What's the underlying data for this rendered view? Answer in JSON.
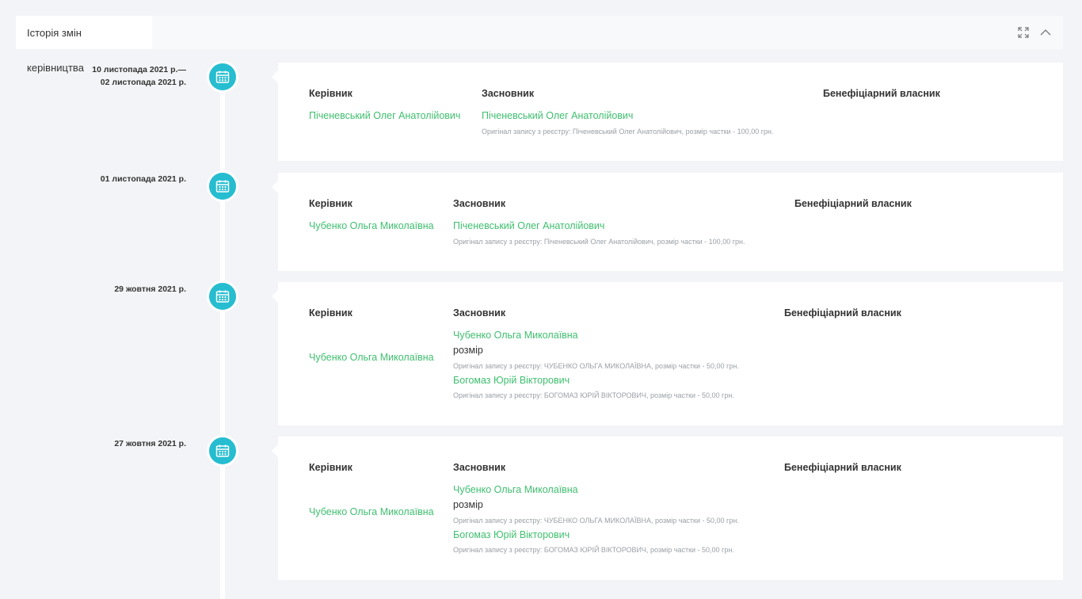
{
  "header": {
    "title": "Історія змін керівництва",
    "expand_icon": "expand-icon",
    "collapse_icon": "chevron-up-icon"
  },
  "colors": {
    "accent": "#26bdd0",
    "link": "#3fbf6f"
  },
  "entries": [
    {
      "date_line1": "10 листопада 2021 р.—",
      "date_line2": "02 листопада 2021 р.",
      "head_manager": "Керівник",
      "head_founder": "Засновник",
      "head_beneficiary": "Бенефіціарний власник",
      "manager": "Піченевський Олег Анатолійович",
      "founders": [
        {
          "name": "Піченевський Олег Анатолійович",
          "note": "Оригінал запису з реєстру: Піченевський Олег Анатолійович, розмір частки - 100,00 грн."
        }
      ]
    },
    {
      "date_line1": "01 листопада 2021 р.",
      "head_manager": "Керівник",
      "head_founder": "Засновник",
      "head_beneficiary": "Бенефіціарний власник",
      "manager": "Чубенко Ольга Миколаївна",
      "founders": [
        {
          "name": "Піченевський Олег Анатолійович",
          "note": "Оригінал запису з реєстру: Піченевський Олег Анатолійович, розмір частки - 100,00 грн."
        }
      ]
    },
    {
      "date_line1": "29 жовтня 2021 р.",
      "head_manager": "Керівник",
      "head_founder": "Засновник",
      "head_beneficiary": "Бенефіціарний власник",
      "manager": "Чубенко Ольга Миколаївна",
      "founders": [
        {
          "name": "Чубенко Ольга Миколаївна",
          "extra": "розмір",
          "note": "Оригінал запису з реєстру: ЧУБЕНКО ОЛЬГА МИКОЛАЇВНА, розмір частки - 50,00 грн."
        },
        {
          "name": "Богомаз Юрій Вікторович",
          "note": "Оригінал запису з реєстру: БОГОМАЗ ЮРІЙ ВІКТОРОВИЧ, розмір частки - 50,00 грн."
        }
      ]
    },
    {
      "date_line1": "27 жовтня 2021 р.",
      "head_manager": "Керівник",
      "head_founder": "Засновник",
      "head_beneficiary": "Бенефіціарний власник",
      "manager": "Чубенко Ольга Миколаївна",
      "founders": [
        {
          "name": "Чубенко Ольга Миколаївна",
          "extra": "розмір",
          "note": "Оригінал запису з реєстру: ЧУБЕНКО ОЛЬГА МИКОЛАЇВНА, розмір частки - 50,00 грн."
        },
        {
          "name": "Богомаз Юрій Вікторович",
          "note": "Оригінал запису з реєстру: БОГОМАЗ ЮРІЙ ВІКТОРОВИЧ, розмір частки - 50,00 грн."
        }
      ]
    }
  ]
}
